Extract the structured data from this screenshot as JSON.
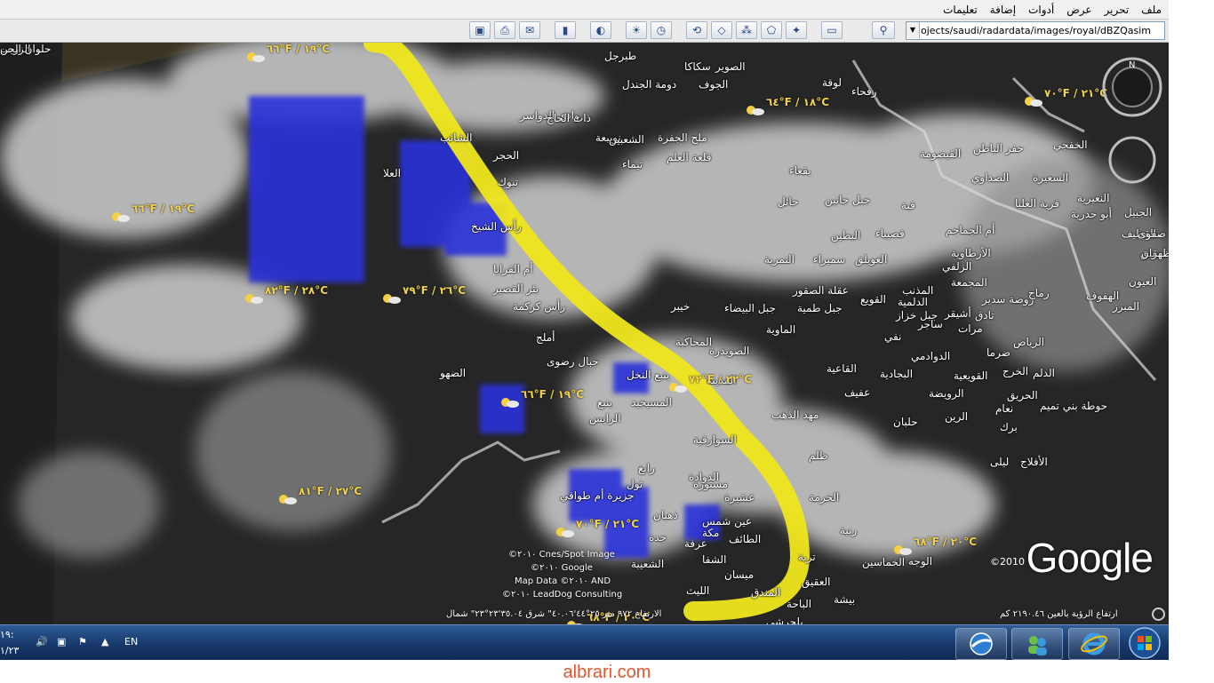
{
  "menu": [
    "ملف",
    "تحرير",
    "عرض",
    "أدوات",
    "إضافة",
    "تعليمات"
  ],
  "address": {
    "value": "ojects/saudi/radardata/images/royal/dBZQasim"
  },
  "map": {
    "labels": [
      {
        "t": "طبرجل"
      },
      {
        "t": "الصوير"
      },
      {
        "t": "سكاكا"
      },
      {
        "t": "الجوف"
      },
      {
        "t": "دومة الجندل"
      },
      {
        "t": "لوقة"
      },
      {
        "t": "رفحاء"
      },
      {
        "t": "الخفجي"
      },
      {
        "t": "حفر الباطن"
      },
      {
        "t": "القيصومة"
      },
      {
        "t": "السعيرة"
      },
      {
        "t": "الصداوي"
      },
      {
        "t": "قرية العليا"
      },
      {
        "t": "النعيرية"
      },
      {
        "t": "أبو حدرية"
      },
      {
        "t": "الجبيل"
      },
      {
        "t": "القطيف"
      },
      {
        "t": "صفوى"
      },
      {
        "t": "بقيق"
      },
      {
        "t": "الظهران"
      },
      {
        "t": "العيون"
      },
      {
        "t": "الهفوف"
      },
      {
        "t": "المبرز"
      },
      {
        "t": "بقعاء"
      },
      {
        "t": "جبل جانين"
      },
      {
        "t": "حائل"
      },
      {
        "t": "قبة"
      },
      {
        "t": "أم الجماجم"
      },
      {
        "t": "قصيباء"
      },
      {
        "t": "البطين"
      },
      {
        "t": "الأرطاوية"
      },
      {
        "t": "الزلفي"
      },
      {
        "t": "الغويلق"
      },
      {
        "t": "سميراء"
      },
      {
        "t": "النمرية"
      },
      {
        "t": "المجمعة"
      },
      {
        "t": "روضة سدير"
      },
      {
        "t": "رماح"
      },
      {
        "t": "عقلة الصقور"
      },
      {
        "t": "المذنب"
      },
      {
        "t": "الدلمية"
      },
      {
        "t": "القويع"
      },
      {
        "t": "تادق"
      },
      {
        "t": "أشيقر"
      },
      {
        "t": "مرات"
      },
      {
        "t": "الرياض"
      },
      {
        "t": "ضرما"
      },
      {
        "t": "جبل خزاز"
      },
      {
        "t": "ساجر"
      },
      {
        "t": "نفي"
      },
      {
        "t": "الدوادمي"
      },
      {
        "t": "الخرج"
      },
      {
        "t": "الدلم"
      },
      {
        "t": "القاعية"
      },
      {
        "t": "البجادية"
      },
      {
        "t": "القويعية"
      },
      {
        "t": "عفيف"
      },
      {
        "t": "الرويضة"
      },
      {
        "t": "الحريق"
      },
      {
        "t": "حوطة بني تميم"
      },
      {
        "t": "نعام"
      },
      {
        "t": "برك"
      },
      {
        "t": "الرين"
      },
      {
        "t": "حلبان"
      },
      {
        "t": "الأفلاج"
      },
      {
        "t": "ليلى"
      },
      {
        "t": "المحاكية"
      },
      {
        "t": "الصويدرة"
      },
      {
        "t": "الماوية"
      },
      {
        "t": "جبل طمية"
      },
      {
        "t": "جبل البيضاء"
      },
      {
        "t": "خيبر"
      },
      {
        "t": "المدينة"
      },
      {
        "t": "مهد الذهب"
      },
      {
        "t": "السوارقية"
      },
      {
        "t": "المسيجيد"
      },
      {
        "t": "ينبع النخل"
      },
      {
        "t": "ينبع"
      },
      {
        "t": "الرايس"
      },
      {
        "t": "ظلم"
      },
      {
        "t": "الخرمة"
      },
      {
        "t": "رنية"
      },
      {
        "t": "تربة"
      },
      {
        "t": "الدوادة"
      },
      {
        "t": "رابغ"
      },
      {
        "t": "مستورة"
      },
      {
        "t": "عشيرة"
      },
      {
        "t": "عين شمس"
      },
      {
        "t": "الطائف"
      },
      {
        "t": "مكة"
      },
      {
        "t": "جدة"
      },
      {
        "t": "ذهبان"
      },
      {
        "t": "ثول"
      },
      {
        "t": "عرفة"
      },
      {
        "t": "الشفا"
      },
      {
        "t": "ميسان"
      },
      {
        "t": "الشعيبة"
      },
      {
        "t": "الليث"
      },
      {
        "t": "العقيق"
      },
      {
        "t": "بيشة"
      },
      {
        "t": "الباحة"
      },
      {
        "t": "المندق"
      },
      {
        "t": "بلجرشي"
      },
      {
        "t": "جزيرة أم طواقي"
      },
      {
        "t": "جبال رضوى"
      },
      {
        "t": "أملج"
      },
      {
        "t": "الضهو"
      },
      {
        "t": "رأس كركمة"
      },
      {
        "t": "بئر القصير"
      },
      {
        "t": "أم القرايا"
      },
      {
        "t": "الوجه"
      },
      {
        "t": "الخماسين"
      },
      {
        "t": "وادي الدواسر"
      },
      {
        "t": "ذات الحاج"
      },
      {
        "t": "الشائب"
      },
      {
        "t": "تبوك"
      },
      {
        "t": "تيماء"
      },
      {
        "t": "العلا"
      },
      {
        "t": "الحجر"
      },
      {
        "t": "رأس الشيخ"
      },
      {
        "t": "نويبعة"
      },
      {
        "t": "الشعبين"
      },
      {
        "t": "ملح الجفرة"
      },
      {
        "t": "قلعة العلم"
      },
      {
        "t": "الزريب"
      },
      {
        "t": "حلوان الجن"
      }
    ],
    "temps": [
      "٦٦°F / ١٩°C",
      "٧٠°F / ٢١°C",
      "٦٤°F / ١٨°C",
      "٦٦°F / ١٩°C",
      "٨٢°F / ٢٨°C",
      "٧٩°F / ٢٦°C",
      "٦٦°F / ١٩°C",
      "٧٢°F / ٢٢°C",
      "٨١°F / ٢٧°C",
      "٧٠°F / ٢١°C",
      "٦٨°F / ٢٠°C",
      "٦٨°F / ٢٠°C"
    ],
    "credits": [
      "©٢٠١٠ Cnes/Spot Image",
      "©٢٠١٠ Google",
      "Map Data ©٢٠١٠ AND",
      "©٢٠١٠ LeadDog Consulting"
    ],
    "logo": "Google",
    "logo_year": "©2010",
    "status_left": "الارتفاع ٩٧٢ متر ٢٥°٤٤'٤٠.٠٦\" شرق ٣٥.٠٤'٢٣°٢٣\" شمال",
    "status_right": "ارتفاع الرؤية بالعين ٢١٩٠.٤٦ كم",
    "compass_n": "N"
  },
  "taskbar": {
    "lang": "EN",
    "clock_time": "١٩:",
    "clock_date": "١/٢٣"
  },
  "watermark": "albrari.com",
  "colors": {
    "storm_track": "#f0e61e",
    "radar_blue": "#2b33d9",
    "taskbar": "#1d427d",
    "watermark": "#e2572c"
  }
}
